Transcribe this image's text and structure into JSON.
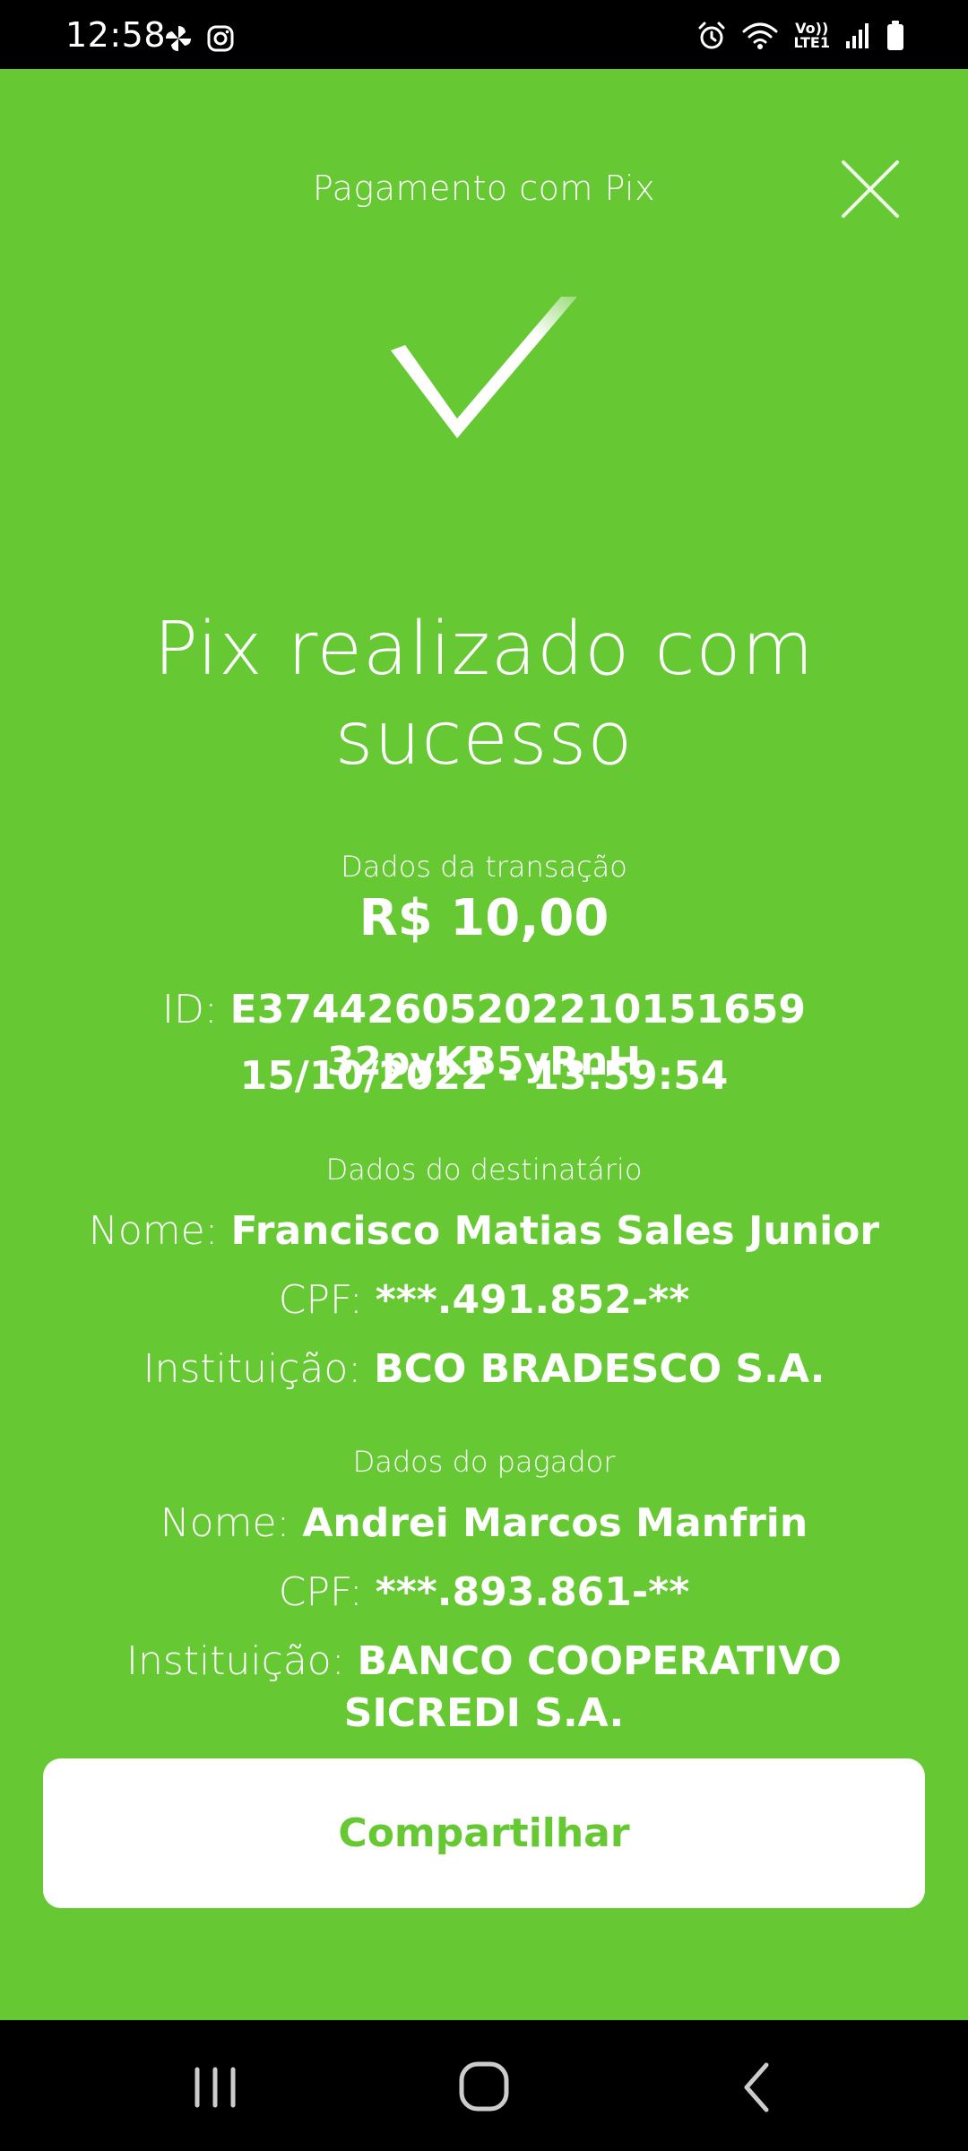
{
  "theme": {
    "green": "#66c832"
  },
  "status_bar": {
    "time": "12:58",
    "left_icons": [
      "pinwheel-icon",
      "instagram-icon"
    ],
    "right_icons": [
      "alarm-icon",
      "wifi-icon",
      "volte-icon",
      "signal-icon",
      "battery-icon"
    ],
    "volte_top": "Vo))",
    "volte_bottom": "LTE1"
  },
  "header": {
    "title": "Pagamento com Pix",
    "close_icon": "close-icon"
  },
  "status_icon": "check-icon",
  "main": {
    "title": "Pix realizado com sucesso"
  },
  "transaction": {
    "label": "Dados da transação",
    "amount": "R$ 10,00",
    "id_key": "ID:",
    "id_value": "E37442605202210151659 32pyKB5yRnH",
    "datetime": "15/10/2022 - 13:59:54"
  },
  "recipient": {
    "label": "Dados do destinatário",
    "name_key": "Nome:",
    "name_value": "Francisco Matias Sales Junior",
    "cpf_key": "CPF:",
    "cpf_value": "***.491.852-**",
    "institution_key": "Instituição:",
    "institution_value": "BCO BRADESCO S.A."
  },
  "payer": {
    "label": "Dados do pagador",
    "name_key": "Nome:",
    "name_value": "Andrei Marcos Manfrin",
    "cpf_key": "CPF:",
    "cpf_value": "***.893.861-**",
    "institution_key": "Instituição:",
    "institution_value": "BANCO COOPERATIVO SICREDI S.A."
  },
  "actions": {
    "share_label": "Compartilhar"
  },
  "nav_bar": {
    "items": [
      "recent-apps-icon",
      "home-icon",
      "back-icon"
    ]
  }
}
